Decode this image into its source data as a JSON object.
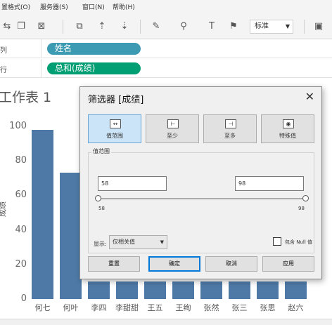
{
  "menu": [
    {
      "label": "置格式(O)"
    },
    {
      "label": "服务器(S)"
    },
    {
      "label": "窗口(N)"
    },
    {
      "label": "帮助(H)"
    }
  ],
  "toolbar": {
    "font_select": "标准"
  },
  "shelves": {
    "columns": {
      "label": "列",
      "pill": "姓名",
      "pill_color": "#3c9ab2"
    },
    "rows": {
      "label": "行",
      "pill": "总和(成绩)",
      "pill_color": "#009e73"
    }
  },
  "worksheet": {
    "title": "工作表 1"
  },
  "chart_data": {
    "type": "bar",
    "categories": [
      "何七",
      "何叶",
      "李四",
      "李甜甜",
      "王五",
      "王绚",
      "张然",
      "张三",
      "张思",
      "赵六"
    ],
    "values": [
      98,
      73,
      10,
      10,
      10,
      10,
      10,
      10,
      10,
      10
    ],
    "ylabel": "成绩",
    "yticks": [
      "100",
      "80",
      "60",
      "40",
      "20",
      "0"
    ],
    "ylim": [
      0,
      100
    ],
    "bar_color": "#4e79a7"
  },
  "dialog": {
    "title": "筛选器 [成绩]",
    "tabs": [
      {
        "label": "值范围",
        "icon": "range-icon"
      },
      {
        "label": "至少",
        "icon": "at-least-icon"
      },
      {
        "label": "至多",
        "icon": "at-most-icon"
      },
      {
        "label": "特殊值",
        "icon": "special-icon"
      }
    ],
    "group_label": "值范围",
    "min_value": "58",
    "max_value": "98",
    "slider_min": "58",
    "slider_max": "98",
    "show_label": "显示:",
    "show_option": "仅相关值",
    "include_null_label": "包含 Null 值",
    "buttons": {
      "reset": "重置",
      "ok": "确定",
      "cancel": "取消",
      "apply": "应用"
    }
  }
}
